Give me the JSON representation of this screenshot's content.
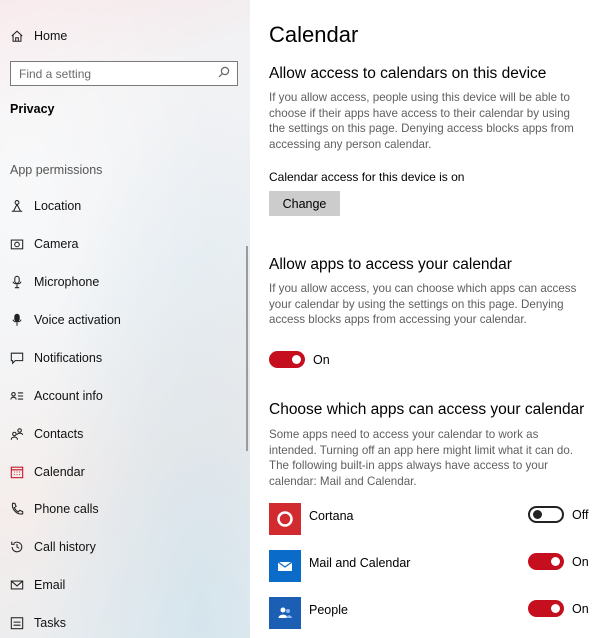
{
  "sidebar": {
    "home_label": "Home",
    "search_placeholder": "Find a setting",
    "section_title": "Privacy",
    "group_label": "App permissions",
    "items": [
      {
        "label": "Location",
        "icon": "location-icon"
      },
      {
        "label": "Camera",
        "icon": "camera-icon"
      },
      {
        "label": "Microphone",
        "icon": "microphone-icon"
      },
      {
        "label": "Voice activation",
        "icon": "voice-activation-icon"
      },
      {
        "label": "Notifications",
        "icon": "notifications-icon"
      },
      {
        "label": "Account info",
        "icon": "account-info-icon"
      },
      {
        "label": "Contacts",
        "icon": "contacts-icon"
      },
      {
        "label": "Calendar",
        "icon": "calendar-icon",
        "active": true
      },
      {
        "label": "Phone calls",
        "icon": "phone-icon"
      },
      {
        "label": "Call history",
        "icon": "history-icon"
      },
      {
        "label": "Email",
        "icon": "email-icon"
      },
      {
        "label": "Tasks",
        "icon": "tasks-icon"
      }
    ]
  },
  "main": {
    "page_title": "Calendar",
    "device_section": {
      "heading": "Allow access to calendars on this device",
      "description": "If you allow access, people using this device will be able to choose if their apps have access to their calendar by using the settings on this page. Denying access blocks apps from accessing any person calendar.",
      "status": "Calendar access for this device is on",
      "change_label": "Change"
    },
    "apps_section": {
      "heading": "Allow apps to access your calendar",
      "description": "If you allow access, you can choose which apps can access your calendar by using the settings on this page. Denying access blocks apps from accessing your calendar.",
      "toggle_label": "On",
      "toggle_on": true
    },
    "choose_section": {
      "heading": "Choose which apps can access your calendar",
      "description": "Some apps need to access your calendar to work as intended. Turning off an app here might limit what it can do. The following built-in apps always have access to your calendar: Mail and Calendar.",
      "apps": [
        {
          "name": "Cortana",
          "toggle_label": "Off",
          "on": false,
          "icon": "cortana-icon"
        },
        {
          "name": "Mail and Calendar",
          "toggle_label": "On",
          "on": true,
          "icon": "mail-calendar-icon"
        },
        {
          "name": "People",
          "toggle_label": "On",
          "on": true,
          "icon": "people-icon"
        }
      ]
    }
  },
  "colors": {
    "accent": "#c50f1f",
    "cortana_tile": "#d12a2f",
    "mail_tile": "#0a6cc8",
    "people_tile": "#1a5fb4",
    "button_gray": "#cccccc"
  }
}
